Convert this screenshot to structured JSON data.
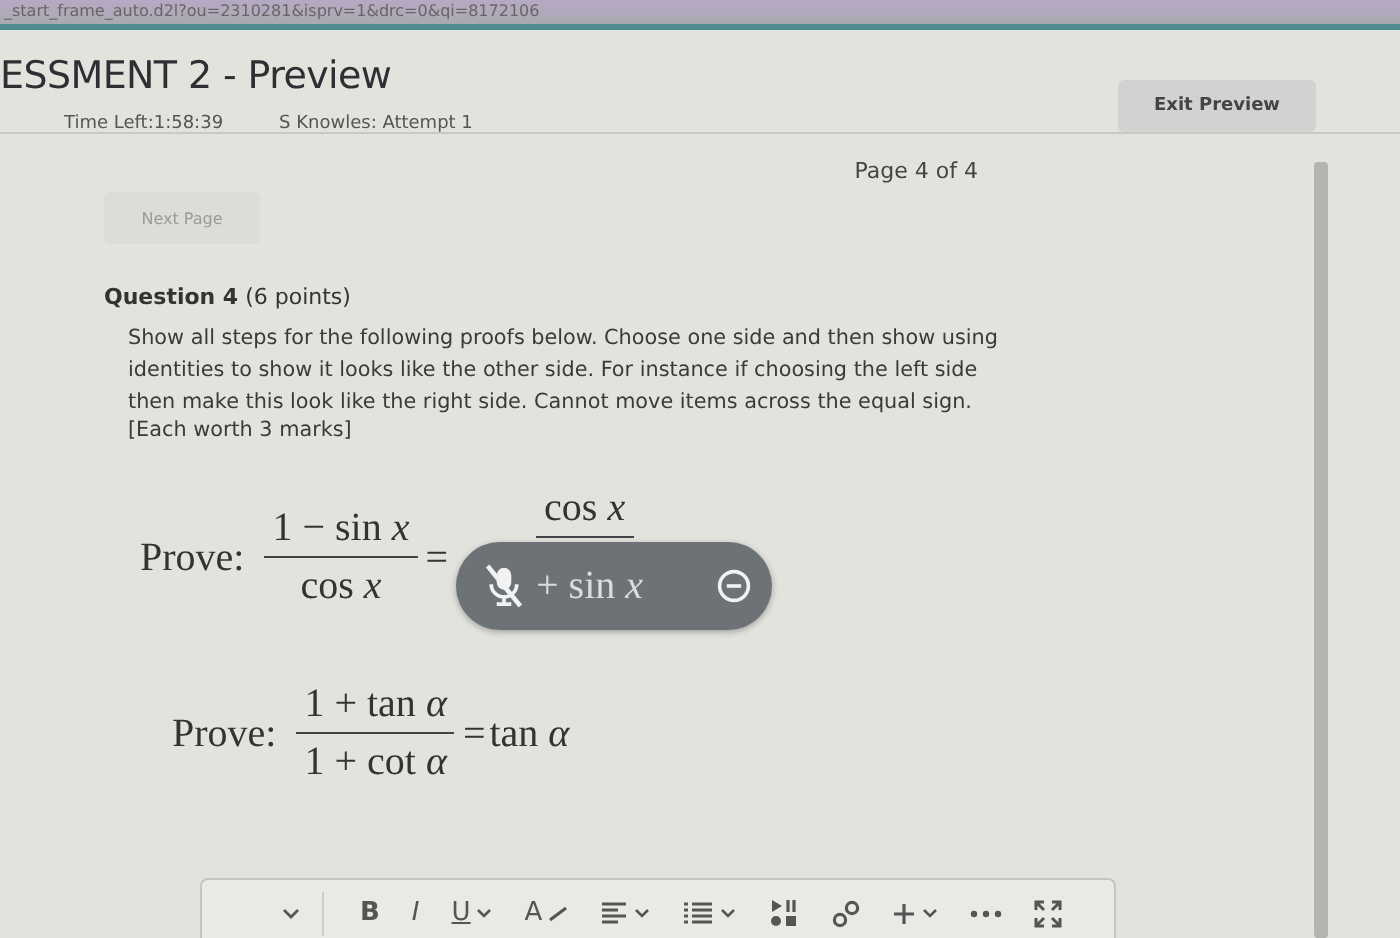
{
  "browser": {
    "address": "_start_frame_auto.d2l?ou=2310281&isprv=1&drc=0&qi=8172106"
  },
  "header": {
    "title": "ESSMENT 2 - Preview",
    "time_left": "Time Left:1:58:39",
    "attempt": "S Knowles: Attempt 1",
    "exit_button": "Exit Preview"
  },
  "page_indicator": "Page 4 of 4",
  "next_button": {
    "label": "Next Page",
    "disabled": true
  },
  "question": {
    "title": "Question 4",
    "points": "(6 points)",
    "instructions": "Show all steps for the following proofs below.  Choose one side and then show using identities to show it looks like the other side.  For instance if choosing the left side then make this look like the right side.  Cannot move items across the equal sign.",
    "marks": "[Each worth 3 marks]",
    "proofs": [
      {
        "label": "Prove:",
        "left": {
          "kind": "fraction",
          "numerator": "1 − sin *x*",
          "denominator": "cos *x*"
        },
        "equals": "=",
        "right": {
          "kind": "fraction",
          "numerator": "cos *x*",
          "denominator": "+ sin *x*"
        },
        "muted_overlay": true
      },
      {
        "label": "Prove:",
        "left": {
          "kind": "fraction",
          "numerator": "1 + tan *α*",
          "denominator": "1 + cot *α*"
        },
        "equals": "=",
        "right": {
          "kind": "plain",
          "text": "tan *α*"
        },
        "muted_overlay": false
      }
    ]
  },
  "toolbar": {
    "items": [
      {
        "kind": "format",
        "label": "B",
        "dropdown": false
      },
      {
        "kind": "format",
        "label": "I",
        "dropdown": false
      },
      {
        "kind": "format",
        "label": "U",
        "dropdown": true
      },
      {
        "kind": "clear",
        "label": "A",
        "dropdown": false
      },
      {
        "kind": "align",
        "dropdown": true
      },
      {
        "kind": "list",
        "dropdown": true
      },
      {
        "kind": "media",
        "dropdown": false
      },
      {
        "kind": "link",
        "dropdown": false
      },
      {
        "kind": "insert",
        "dropdown": true
      },
      {
        "kind": "more",
        "dropdown": false
      },
      {
        "kind": "fullscreen",
        "dropdown": false
      }
    ]
  }
}
